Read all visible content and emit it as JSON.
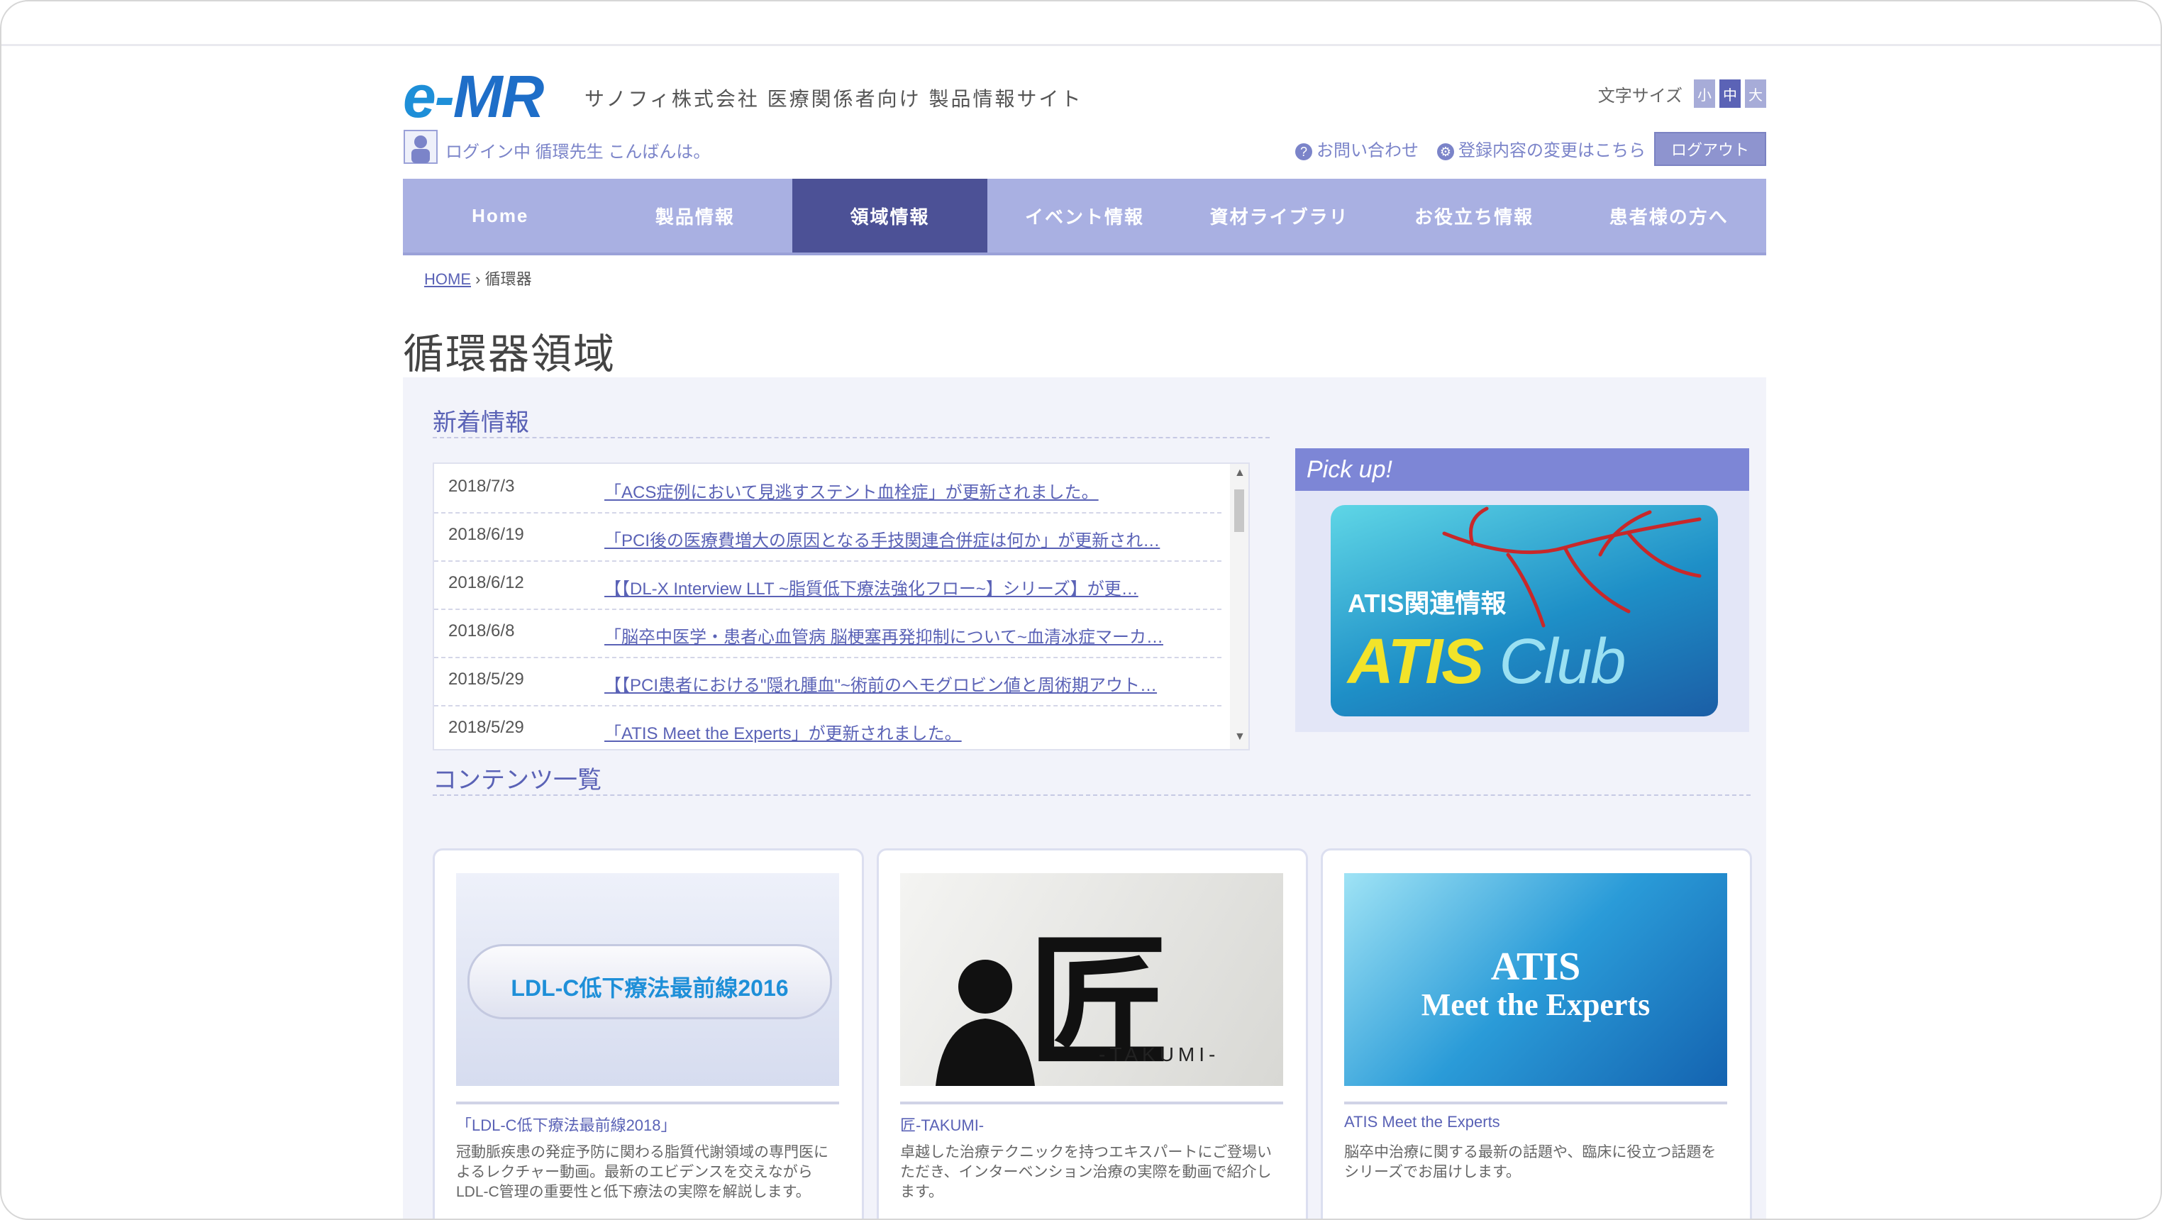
{
  "header": {
    "logo_e": "e-",
    "logo_mr": "MR",
    "site_description": "サノフィ株式会社 医療関係者向け 製品情報サイト",
    "font_size_label": "文字サイズ",
    "font_size_options": [
      "小",
      "中",
      "大"
    ],
    "login_text": "ログイン中 循環先生 こんばんは。",
    "util_links": [
      "お問い合わせ",
      "登録内容の変更はこちら"
    ],
    "logout_label": "ログアウト"
  },
  "nav": {
    "items": [
      "Home",
      "製品情報",
      "領域情報",
      "イベント情報",
      "資材ライブラリ",
      "お役立ち情報",
      "患者様の方へ"
    ],
    "active_index": 2
  },
  "breadcrumb": {
    "home": "HOME",
    "current": "循環器"
  },
  "page_title": "循環器領域",
  "news": {
    "heading": "新着情報",
    "items": [
      {
        "date": "2018/7/3",
        "text": "「ACS症例において見逃すステント血栓症」が更新されました。"
      },
      {
        "date": "2018/6/19",
        "text": "「PCI後の医療費増大の原因となる手技関連合併症は何か」が更新され…"
      },
      {
        "date": "2018/6/12",
        "text": "【【DL-X Interview LLT ~脂質低下療法強化フロー~】シリーズ】が更…"
      },
      {
        "date": "2018/6/8",
        "text": "「脳卒中医学・患者心血管病 脳梗塞再発抑制について~血清冰症マーカ…"
      },
      {
        "date": "2018/5/29",
        "text": "【【PCI患者における\"隠れ腫血\"~術前のヘモグロビン値と周術期アウト…"
      },
      {
        "date": "2018/5/29",
        "text": "「ATIS Meet the Experts」が更新されました。"
      }
    ]
  },
  "pickup": {
    "heading": "Pick up!",
    "banner_title": "ATIS関連情報",
    "banner_logo_main": "ATIS",
    "banner_logo_sub": "Club"
  },
  "contents": {
    "heading": "コンテンツ一覧",
    "cards": [
      {
        "image_text": "LDL-C低下療法最前線2016",
        "title": "「LDL-C低下療法最前線2018」",
        "desc": "冠動脈疾患の発症予防に関わる脂質代謝領域の専門医によるレクチャー動画。最新のエビデンスを交えながらLDL-C管理の重要性と低下療法の実際を解説します。"
      },
      {
        "image_text": "匠",
        "image_sub": "-TAKUMI-",
        "title": "匠-TAKUMI-",
        "desc": "卓越した治療テクニックを持つエキスパートにご登場いただき、インターベンション治療の実際を動画で紹介します。"
      },
      {
        "image_text": "ATIS",
        "image_sub": "Meet the Experts",
        "title": "ATIS Meet the Experts",
        "desc": "脳卒中治療に関する最新の話題や、臨床に役立つ話題をシリーズでお届けします。"
      }
    ]
  },
  "colors": {
    "nav_bg": "#a9b0e2",
    "nav_active": "#4c5196",
    "accent_link": "#5a62b6",
    "panel_bg": "#f2f3fa"
  }
}
